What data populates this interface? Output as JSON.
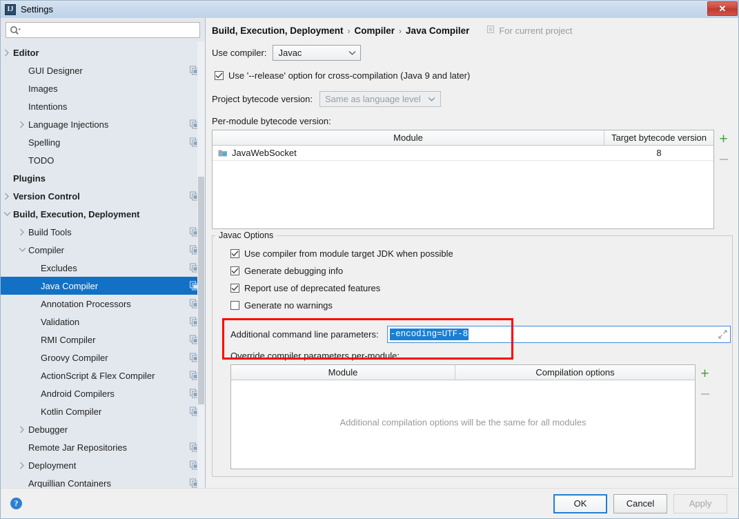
{
  "window": {
    "title": "Settings",
    "app_icon": "intellij-idea-icon",
    "close_label": "✕"
  },
  "sidebar": {
    "search": {
      "placeholder": "",
      "value": "",
      "icon": "search-icon"
    },
    "items": [
      {
        "label": "Editor",
        "level": 0,
        "bold": true,
        "twisty": "collapsed",
        "settings_icon": false,
        "selected": false
      },
      {
        "label": "GUI Designer",
        "level": 1,
        "bold": false,
        "twisty": "none",
        "settings_icon": true,
        "selected": false
      },
      {
        "label": "Images",
        "level": 1,
        "bold": false,
        "twisty": "none",
        "settings_icon": false,
        "selected": false
      },
      {
        "label": "Intentions",
        "level": 1,
        "bold": false,
        "twisty": "none",
        "settings_icon": false,
        "selected": false
      },
      {
        "label": "Language Injections",
        "level": 1,
        "bold": false,
        "twisty": "collapsed",
        "settings_icon": true,
        "selected": false
      },
      {
        "label": "Spelling",
        "level": 1,
        "bold": false,
        "twisty": "none",
        "settings_icon": true,
        "selected": false
      },
      {
        "label": "TODO",
        "level": 1,
        "bold": false,
        "twisty": "none",
        "settings_icon": false,
        "selected": false
      },
      {
        "label": "Plugins",
        "level": 0,
        "bold": true,
        "twisty": "none",
        "settings_icon": false,
        "selected": false
      },
      {
        "label": "Version Control",
        "level": 0,
        "bold": true,
        "twisty": "collapsed",
        "settings_icon": true,
        "selected": false
      },
      {
        "label": "Build, Execution, Deployment",
        "level": 0,
        "bold": true,
        "twisty": "expanded",
        "settings_icon": false,
        "selected": false
      },
      {
        "label": "Build Tools",
        "level": 1,
        "bold": false,
        "twisty": "collapsed",
        "settings_icon": true,
        "selected": false
      },
      {
        "label": "Compiler",
        "level": 1,
        "bold": false,
        "twisty": "expanded",
        "settings_icon": true,
        "selected": false
      },
      {
        "label": "Excludes",
        "level": 2,
        "bold": false,
        "twisty": "none",
        "settings_icon": true,
        "selected": false
      },
      {
        "label": "Java Compiler",
        "level": 2,
        "bold": false,
        "twisty": "none",
        "settings_icon": true,
        "selected": true
      },
      {
        "label": "Annotation Processors",
        "level": 2,
        "bold": false,
        "twisty": "none",
        "settings_icon": true,
        "selected": false
      },
      {
        "label": "Validation",
        "level": 2,
        "bold": false,
        "twisty": "none",
        "settings_icon": true,
        "selected": false
      },
      {
        "label": "RMI Compiler",
        "level": 2,
        "bold": false,
        "twisty": "none",
        "settings_icon": true,
        "selected": false
      },
      {
        "label": "Groovy Compiler",
        "level": 2,
        "bold": false,
        "twisty": "none",
        "settings_icon": true,
        "selected": false
      },
      {
        "label": "ActionScript & Flex Compiler",
        "level": 2,
        "bold": false,
        "twisty": "none",
        "settings_icon": true,
        "selected": false
      },
      {
        "label": "Android Compilers",
        "level": 2,
        "bold": false,
        "twisty": "none",
        "settings_icon": true,
        "selected": false
      },
      {
        "label": "Kotlin Compiler",
        "level": 2,
        "bold": false,
        "twisty": "none",
        "settings_icon": true,
        "selected": false
      },
      {
        "label": "Debugger",
        "level": 1,
        "bold": false,
        "twisty": "collapsed",
        "settings_icon": false,
        "selected": false
      },
      {
        "label": "Remote Jar Repositories",
        "level": 1,
        "bold": false,
        "twisty": "none",
        "settings_icon": true,
        "selected": false
      },
      {
        "label": "Deployment",
        "level": 1,
        "bold": false,
        "twisty": "collapsed",
        "settings_icon": true,
        "selected": false
      },
      {
        "label": "Arquillian Containers",
        "level": 1,
        "bold": false,
        "twisty": "none",
        "settings_icon": true,
        "selected": false
      }
    ]
  },
  "main": {
    "breadcrumb": [
      "Build, Execution, Deployment",
      "Compiler",
      "Java Compiler"
    ],
    "breadcrumb_separator": "›",
    "scope_note": "For current project",
    "scope_icon": "project-scope-icon",
    "use_compiler": {
      "label": "Use compiler:",
      "value": "Javac"
    },
    "release_option": {
      "label": "Use '--release' option for cross-compilation (Java 9 and later)",
      "checked": true
    },
    "project_bytecode": {
      "label": "Project bytecode version:",
      "value": "Same as language level",
      "disabled": true
    },
    "per_module_label": "Per-module bytecode version:",
    "module_table": {
      "columns": [
        "Module",
        "Target bytecode version"
      ],
      "rows": [
        {
          "module": "JavaWebSocket",
          "target": "8",
          "icon": "module-icon"
        }
      ],
      "add_label": "+",
      "remove_label": "−"
    },
    "javac_options": {
      "legend": "Javac Options",
      "checkboxes": [
        {
          "label": "Use compiler from module target JDK when possible",
          "checked": true
        },
        {
          "label": "Generate debugging info",
          "checked": true
        },
        {
          "label": "Report use of deprecated features",
          "checked": true
        },
        {
          "label": "Generate no warnings",
          "checked": false
        }
      ],
      "additional_params": {
        "label": "Additional command line parameters:",
        "value": "-encoding=UTF-8",
        "selected": true,
        "expand_icon": "expand-icon",
        "highlight_color": "#ff0000"
      },
      "override_label": "Override compiler parameters per-module:",
      "override_table": {
        "columns": [
          "Module",
          "Compilation options"
        ],
        "rows": [],
        "empty_message": "Additional compilation options will be the same for all modules",
        "add_label": "+",
        "remove_label": "−"
      }
    }
  },
  "footer": {
    "help_label": "?",
    "ok_label": "OK",
    "cancel_label": "Cancel",
    "apply_label": "Apply",
    "apply_disabled": true
  },
  "colors": {
    "selection_blue": "#1271c4",
    "text_selection_blue": "#1a7fd4",
    "highlight_red": "#ff0000",
    "accent_green": "#45a045",
    "focus_border": "#1f7fd4"
  }
}
